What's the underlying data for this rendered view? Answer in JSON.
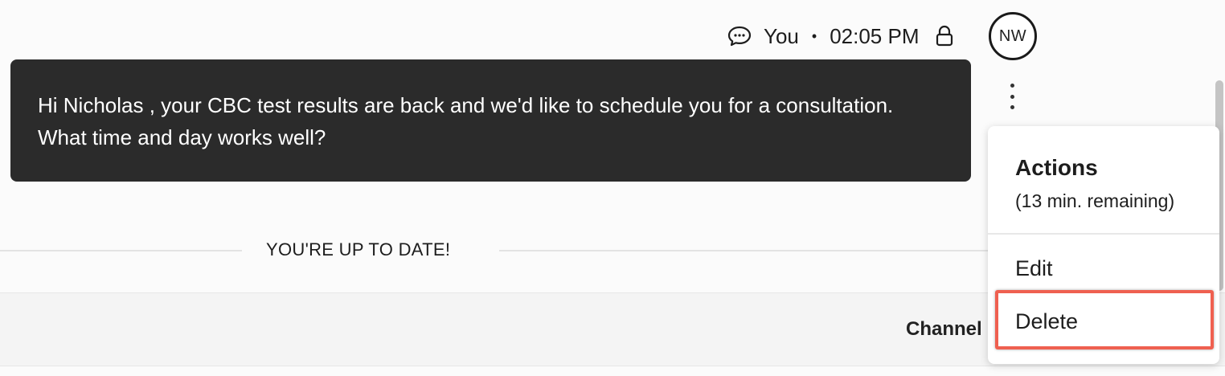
{
  "message_meta": {
    "icon": "chat-bubble-icon",
    "sender": "You",
    "separator": "•",
    "time": "02:05 PM",
    "lock_icon": "lock-icon"
  },
  "avatar": {
    "initials": "NW"
  },
  "message": {
    "text": "Hi Nicholas , your CBC test results are back and we'd like to schedule you for a consultation. What time and day works well?"
  },
  "status": {
    "up_to_date": "YOU'RE UP TO DATE!"
  },
  "bottom_bar": {
    "channel_label": "Channel"
  },
  "actions_menu": {
    "title": "Actions",
    "subtitle": "(13 min. remaining)",
    "items": [
      {
        "label": "Edit"
      },
      {
        "label": "Delete"
      }
    ],
    "highlight_color": "#ef6050"
  },
  "colors": {
    "bubble_bg": "#2b2b2b",
    "page_bg": "#fbfbfb"
  }
}
